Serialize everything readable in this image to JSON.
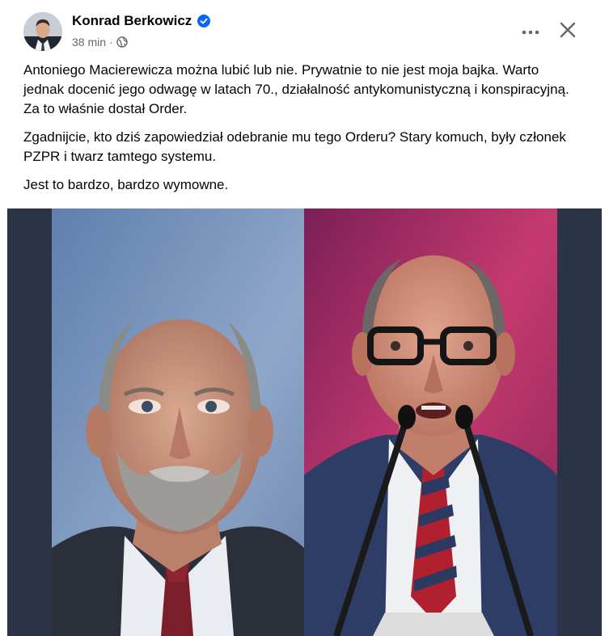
{
  "post": {
    "author": {
      "name": "Konrad Berkowicz",
      "verified": true
    },
    "meta": {
      "time": "38 min",
      "separator": "·",
      "audience_icon": "globe-icon"
    },
    "actions": {
      "more_icon": "more-options-icon",
      "close_icon": "close-icon"
    },
    "paragraphs": [
      "Antoniego Macierewicza można lubić lub nie. Prywatnie to nie jest moja bajka. Warto jednak docenić jego odwagę w latach 70., działalność antykomunistyczną i konspiracyjną. Za to właśnie dostał Order.",
      "Zgadnijcie, kto dziś zapowiedział odebranie mu tego Orderu? Stary komuch, były członek PZPR i twarz tamtego systemu.",
      "Jest to bardzo, bardzo wymowne."
    ],
    "colors": {
      "text": "#050505",
      "meta": "#65676b",
      "verified": "#0866ff",
      "media_background": "#2b3446"
    }
  }
}
